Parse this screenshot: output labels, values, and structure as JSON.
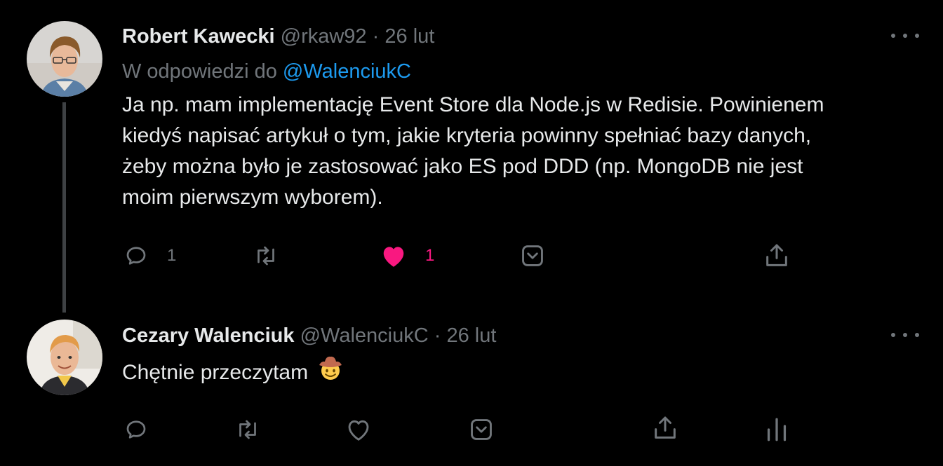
{
  "tweets": [
    {
      "author_name": "Robert Kawecki",
      "handle": "@rkaw92",
      "separator": "·",
      "date": "26 lut",
      "reply_prefix": "W odpowiedzi do",
      "reply_to": "@WalenciukC",
      "lines": [
        "Ja np. mam implementację Event Store dla Node.js w Redisie. Powinienem",
        "kiedyś napisać artykuł o tym, jakie kryteria powinny spełniać bazy danych,",
        "żeby można było je zastosować jako ES pod DDD (np. MongoDB nie jest",
        "moim pierwszym wyborem)."
      ],
      "reply_count": "1",
      "like_count": "1",
      "liked": true,
      "icons": [
        "reply-icon",
        "retweet-icon",
        "like-icon-filled",
        "save-icon",
        "share-icon"
      ]
    },
    {
      "author_name": "Cezary Walenciuk",
      "handle": "@WalenciukC",
      "separator": "·",
      "date": "26 lut",
      "text": "Chętnie przeczytam",
      "emoji": "cowboy-emoji",
      "icons": [
        "reply-icon",
        "retweet-icon",
        "like-icon",
        "save-icon",
        "share-icon",
        "analytics-icon"
      ]
    }
  ],
  "colors": {
    "background": "#000000",
    "text": "#e7e9ea",
    "muted": "#71767b",
    "mention": "#1d9bf0",
    "like": "#f91880"
  }
}
